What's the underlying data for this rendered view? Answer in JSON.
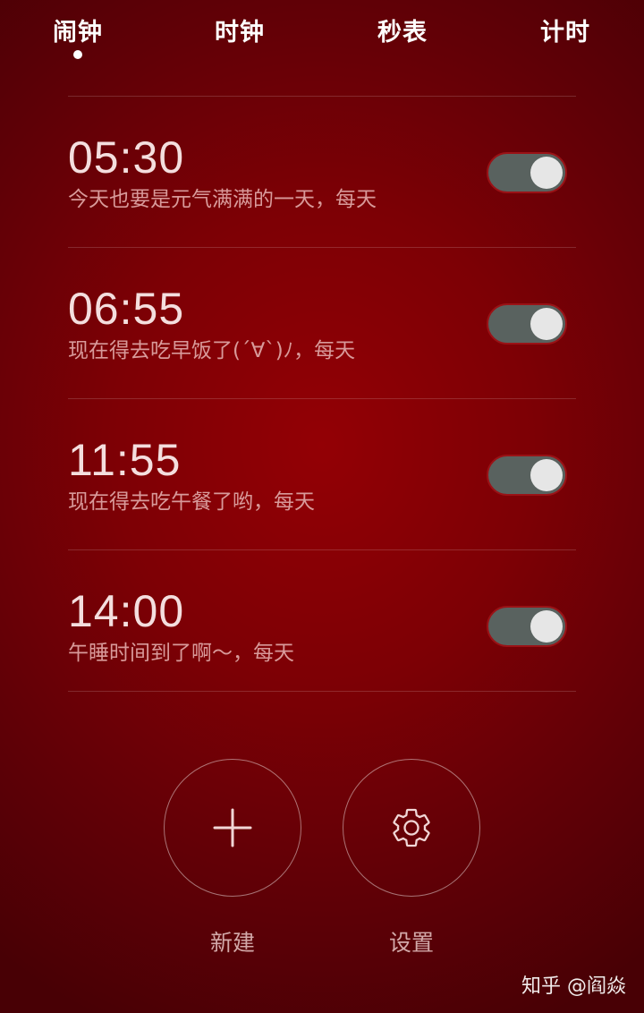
{
  "tabs": [
    {
      "label": "闹钟",
      "active": true
    },
    {
      "label": "时钟",
      "active": false
    },
    {
      "label": "秒表",
      "active": false
    },
    {
      "label": "计时",
      "active": false
    }
  ],
  "alarms": [
    {
      "time": "05:30",
      "label": "今天也要是元气满满的一天，每天",
      "enabled": true
    },
    {
      "time": "06:55",
      "label": "现在得去吃早饭了(´∀`)ﾉ，每天",
      "enabled": true
    },
    {
      "time": "11:55",
      "label": "现在得去吃午餐了哟，每天",
      "enabled": true
    },
    {
      "time": "14:00",
      "label": "午睡时间到了啊～，每天",
      "enabled": true
    }
  ],
  "actions": {
    "new_label": "新建",
    "settings_label": "设置"
  },
  "icons": {
    "new": "plus-icon",
    "settings": "gear-icon"
  },
  "colors": {
    "background": "#7d0005",
    "toggle_track": "#59625f",
    "toggle_knob": "#e6e6e6"
  },
  "watermark": "知乎 @阎焱"
}
